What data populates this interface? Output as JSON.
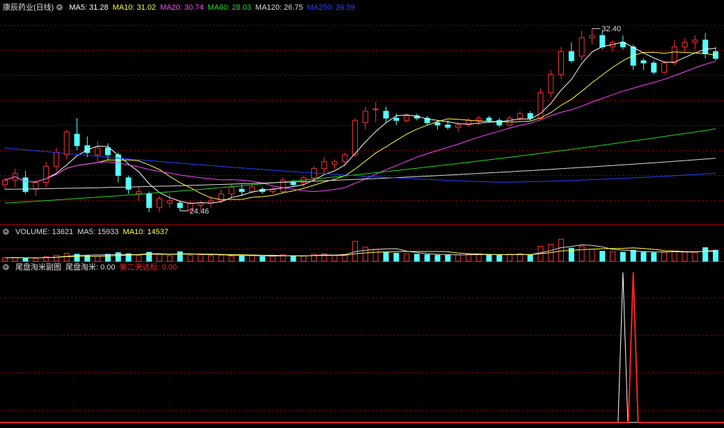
{
  "main": {
    "title": "康辰药业(日线)",
    "ma": [
      {
        "label": "MA5: 31.28",
        "color": "#ffffff"
      },
      {
        "label": "MA10: 31.02",
        "color": "#ffff44"
      },
      {
        "label": "MA20: 30.74",
        "color": "#ff44ff"
      },
      {
        "label": "MA60: 28.03",
        "color": "#22dd22"
      },
      {
        "label": "MA120: 26.75",
        "color": "#dddddd"
      },
      {
        "label": "MA250: 26.59",
        "color": "#2244ff"
      }
    ],
    "high_label": "32.40",
    "low_label": "24.46"
  },
  "volume": {
    "items": [
      {
        "label": "VOLUME: 13621",
        "color": "#dddddd"
      },
      {
        "label": "MA5: 15933",
        "color": "#dddddd"
      },
      {
        "label": "MA10: 14537",
        "color": "#ffff44"
      }
    ]
  },
  "indicator": {
    "items": [
      {
        "label": "尾盘淘米副图",
        "color": "#dddddd"
      },
      {
        "label": "尾盘淘米: 0.00",
        "color": "#dddddd"
      },
      {
        "label": "第二天达标: 0.00",
        "color": "#ff2222"
      }
    ]
  },
  "colors": {
    "up": "#ff3232",
    "down": "#54ffff",
    "grid": "#7a0000",
    "axis": "#b00000"
  },
  "chart_data": [
    {
      "type": "candlestick",
      "title": "康辰药业(日线)",
      "bars": [
        [
          25.6,
          25.9,
          25.4,
          25.8
        ],
        [
          25.8,
          26.3,
          25.5,
          26.1
        ],
        [
          25.9,
          26.2,
          25.2,
          25.3
        ],
        [
          25.4,
          25.8,
          25.1,
          25.7
        ],
        [
          25.7,
          26.6,
          25.5,
          26.4
        ],
        [
          26.4,
          27.2,
          26.2,
          27.0
        ],
        [
          26.9,
          28.0,
          26.7,
          27.9
        ],
        [
          27.8,
          28.5,
          27.1,
          27.3
        ],
        [
          27.3,
          27.7,
          26.8,
          27.0
        ],
        [
          26.9,
          27.5,
          26.6,
          27.2
        ],
        [
          27.2,
          27.4,
          26.7,
          26.9
        ],
        [
          26.9,
          27.0,
          25.7,
          26.0
        ],
        [
          25.9,
          26.0,
          25.2,
          25.4
        ],
        [
          25.2,
          25.5,
          24.9,
          25.3
        ],
        [
          25.2,
          25.3,
          24.4,
          24.6
        ],
        [
          24.6,
          25.1,
          24.4,
          25.0
        ],
        [
          24.8,
          25.2,
          24.6,
          24.9
        ],
        [
          24.8,
          24.9,
          24.46,
          24.6
        ],
        [
          24.5,
          24.9,
          24.4,
          24.8
        ],
        [
          24.7,
          24.9,
          24.5,
          24.8
        ],
        [
          24.8,
          25.1,
          24.6,
          24.9
        ],
        [
          24.9,
          25.4,
          24.8,
          25.2
        ],
        [
          25.2,
          25.6,
          25.0,
          25.5
        ],
        [
          25.4,
          25.6,
          25.1,
          25.3
        ],
        [
          25.3,
          25.6,
          25.2,
          25.5
        ],
        [
          25.4,
          25.5,
          25.2,
          25.3
        ],
        [
          25.3,
          25.5,
          25.2,
          25.4
        ],
        [
          25.3,
          25.9,
          25.2,
          25.8
        ],
        [
          25.7,
          25.8,
          25.5,
          25.6
        ],
        [
          25.7,
          26.0,
          25.5,
          25.9
        ],
        [
          25.9,
          26.4,
          25.7,
          26.3
        ],
        [
          26.3,
          26.8,
          26.1,
          26.6
        ],
        [
          26.5,
          26.7,
          26.3,
          26.6
        ],
        [
          26.6,
          27.0,
          26.4,
          26.9
        ],
        [
          26.9,
          28.5,
          26.8,
          28.4
        ],
        [
          28.3,
          29.0,
          28.0,
          28.8
        ],
        [
          28.9,
          29.2,
          28.3,
          28.9
        ],
        [
          28.8,
          29.0,
          28.3,
          28.5
        ],
        [
          28.5,
          28.7,
          28.2,
          28.4
        ],
        [
          28.4,
          28.7,
          28.3,
          28.6
        ],
        [
          28.6,
          28.7,
          28.4,
          28.5
        ],
        [
          28.5,
          28.6,
          28.2,
          28.3
        ],
        [
          28.3,
          28.4,
          28.0,
          28.2
        ],
        [
          28.2,
          28.4,
          28.0,
          28.1
        ],
        [
          28.1,
          28.3,
          27.9,
          28.2
        ],
        [
          28.2,
          28.5,
          28.1,
          28.4
        ],
        [
          28.4,
          28.6,
          28.2,
          28.5
        ],
        [
          28.5,
          28.6,
          28.3,
          28.4
        ],
        [
          28.4,
          28.5,
          28.1,
          28.2
        ],
        [
          28.2,
          28.6,
          28.1,
          28.5
        ],
        [
          28.5,
          28.8,
          28.4,
          28.7
        ],
        [
          28.7,
          28.8,
          28.4,
          28.5
        ],
        [
          28.5,
          29.8,
          28.4,
          29.6
        ],
        [
          29.6,
          30.6,
          29.4,
          30.4
        ],
        [
          30.4,
          31.6,
          30.2,
          31.4
        ],
        [
          31.4,
          31.8,
          30.9,
          31.0
        ],
        [
          31.2,
          32.3,
          31.0,
          32.0
        ],
        [
          32.0,
          32.4,
          31.7,
          32.1
        ],
        [
          32.1,
          32.3,
          31.5,
          31.6
        ],
        [
          31.6,
          31.9,
          31.4,
          31.8
        ],
        [
          31.8,
          32.1,
          31.5,
          31.6
        ],
        [
          31.6,
          31.7,
          30.6,
          30.8
        ],
        [
          31.0,
          31.1,
          30.6,
          30.9
        ],
        [
          30.9,
          31.0,
          30.4,
          30.5
        ],
        [
          30.5,
          31.0,
          30.4,
          30.9
        ],
        [
          30.9,
          31.9,
          30.8,
          31.6
        ],
        [
          31.6,
          32.0,
          31.4,
          31.8
        ],
        [
          31.8,
          32.1,
          31.5,
          31.9
        ],
        [
          31.9,
          32.2,
          31.1,
          31.3
        ],
        [
          31.4,
          31.6,
          31.0,
          31.1
        ]
      ],
      "ma5_last": 31.28,
      "ma10_last": 31.02,
      "ma20_last": 30.74,
      "ma60_last": 28.03,
      "ma120_last": 26.75,
      "ma250_last": 26.59,
      "high": 32.4,
      "low": 24.46,
      "ylim": [
        23.9,
        33.1
      ]
    },
    {
      "type": "bar",
      "title": "VOLUME",
      "values": [
        3500,
        3800,
        3200,
        3000,
        4500,
        6000,
        8000,
        7000,
        5500,
        5000,
        7000,
        8500,
        7500,
        6000,
        9000,
        7000,
        5500,
        9500,
        6000,
        6500,
        5500,
        6000,
        5000,
        5500,
        6000,
        4500,
        5000,
        6500,
        5000,
        5500,
        7000,
        7500,
        6000,
        7000,
        20000,
        14000,
        12000,
        9000,
        8000,
        7500,
        7000,
        6500,
        6000,
        6000,
        6500,
        7000,
        7500,
        6500,
        6000,
        7000,
        7500,
        6500,
        15000,
        17000,
        22000,
        13000,
        15000,
        12000,
        10000,
        9500,
        9000,
        11000,
        9000,
        8500,
        9000,
        10000,
        9500,
        9000,
        13621,
        11000
      ],
      "ma5_last": 15933,
      "ma10_last": 14537,
      "ylim": [
        0,
        25000
      ]
    },
    {
      "type": "line",
      "title": "尾盘淘米副图",
      "series": [
        {
          "name": "尾盘淘米",
          "values": [
            0,
            0,
            0,
            0,
            0,
            0,
            0,
            0,
            0,
            0,
            0,
            0,
            0,
            0,
            0,
            0,
            0,
            0,
            0,
            0,
            0,
            0,
            0,
            0,
            0,
            0,
            0,
            0,
            0,
            0,
            0,
            0,
            0,
            0,
            0,
            0,
            0,
            0,
            0,
            0,
            0,
            0,
            0,
            0,
            0,
            0,
            0,
            0,
            0,
            0,
            0,
            0,
            0,
            0,
            0,
            0,
            0,
            0,
            0,
            0,
            0,
            0,
            0,
            0,
            0,
            0,
            0,
            0,
            0,
            0
          ],
          "color": "#ffffff",
          "spike_at": 60
        },
        {
          "name": "第二天达标",
          "values": [
            0,
            0,
            0,
            0,
            0,
            0,
            0,
            0,
            0,
            0,
            0,
            0,
            0,
            0,
            0,
            0,
            0,
            0,
            0,
            0,
            0,
            0,
            0,
            0,
            0,
            0,
            0,
            0,
            0,
            0,
            0,
            0,
            0,
            0,
            0,
            0,
            0,
            0,
            0,
            0,
            0,
            0,
            0,
            0,
            0,
            0,
            0,
            0,
            0,
            0,
            0,
            0,
            0,
            0,
            0,
            0,
            0,
            0,
            0,
            0,
            0,
            0,
            0,
            0,
            0,
            0,
            0,
            0,
            0,
            0
          ],
          "color": "#ff2222",
          "spike_at": 61
        }
      ],
      "ylim": [
        0,
        1
      ]
    }
  ]
}
